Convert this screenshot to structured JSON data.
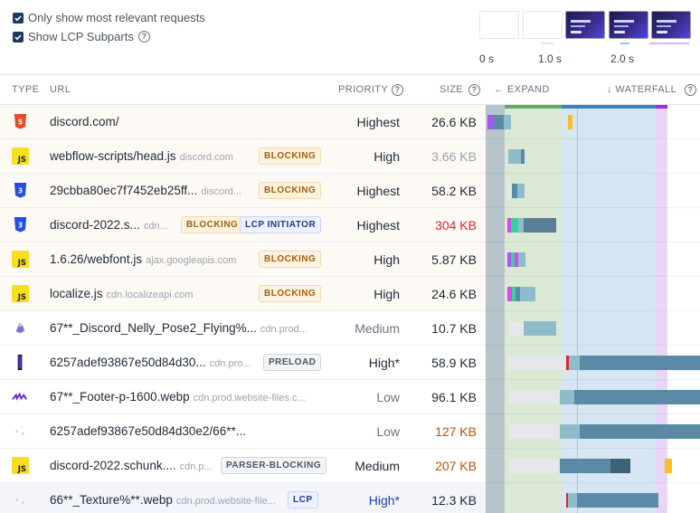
{
  "options": {
    "relevant_label": "Only show most relevant requests",
    "relevant_checked": true,
    "lcp_label": "Show LCP Subparts",
    "lcp_checked": true
  },
  "filmstrip": {
    "labels": [
      "0 s",
      "1.0 s",
      "2.0 s"
    ]
  },
  "header": {
    "type": "TYPE",
    "url": "URL",
    "priority": "PRIORITY",
    "size": "SIZE",
    "expand": "EXPAND",
    "waterfall": "WATERFALL"
  },
  "colors": {
    "html": "#e34c26",
    "js": "#f7df1e",
    "css": "#264de4",
    "bar_main": "#5a8aa6",
    "bar_light": "#8fbccb",
    "lcp_purple": "#a855f7"
  },
  "rows": [
    {
      "icon": "html-file-icon",
      "url": "discord.com/",
      "host": "",
      "badges": [],
      "priority": "Highest",
      "size": "26.6 KB"
    },
    {
      "icon": "js-file-icon",
      "url": "webflow-scripts/head.js",
      "host": "discord.com",
      "badges": [
        "BLOCKING"
      ],
      "priority": "High",
      "size": "3.66 KB"
    },
    {
      "icon": "css-file-icon",
      "url": "29cbba80ec7f7452eb25ff...",
      "host": "discord...",
      "badges": [
        "BLOCKING"
      ],
      "priority": "Highest",
      "size": "58.2 KB"
    },
    {
      "icon": "css-file-icon",
      "url": "discord-2022.s...",
      "host": "cdn...",
      "badges": [
        "BLOCKING",
        "LCP INITIATOR"
      ],
      "priority": "Highest",
      "size": "304 KB"
    },
    {
      "icon": "js-file-icon",
      "url": "1.6.26/webfont.js",
      "host": "ajax.googleapis.com",
      "badges": [
        "BLOCKING"
      ],
      "priority": "High",
      "size": "5.87 KB"
    },
    {
      "icon": "js-file-icon",
      "url": "localize.js",
      "host": "cdn.localizeapi.com",
      "badges": [
        "BLOCKING"
      ],
      "priority": "High",
      "size": "24.6 KB"
    },
    {
      "icon": "image-thumbnail-icon",
      "url": "67**_Discord_Nelly_Pose2_Flying%...",
      "host": "cdn.prod...",
      "badges": [],
      "priority": "Medium",
      "size": "10.7 KB"
    },
    {
      "icon": "image-thumbnail-icon",
      "url": "6257adef93867e50d84d30...",
      "host": "cdn.pro...",
      "badges": [
        "PRELOAD"
      ],
      "priority": "High*",
      "size": "58.9 KB"
    },
    {
      "icon": "image-thumbnail-icon",
      "url": "67**_Footer-p-1600.webp",
      "host": "cdn.prod.website-files.c...",
      "badges": [],
      "priority": "Low",
      "size": "96.1 KB"
    },
    {
      "icon": "image-thumbnail-icon",
      "url": "6257adef93867e50d84d30e2/66**...",
      "host": "",
      "badges": [],
      "priority": "Low",
      "size": "127 KB"
    },
    {
      "icon": "js-file-icon",
      "url": "discord-2022.schunk....",
      "host": "cdn.p...",
      "badges": [
        "PARSER-BLOCKING"
      ],
      "priority": "Medium",
      "size": "207 KB"
    },
    {
      "icon": "image-thumbnail-icon",
      "url": "66**_Texture%**.webp",
      "host": "cdn.prod.website-file...",
      "badges": [
        "LCP"
      ],
      "priority": "High*",
      "size": "12.3 KB"
    }
  ]
}
